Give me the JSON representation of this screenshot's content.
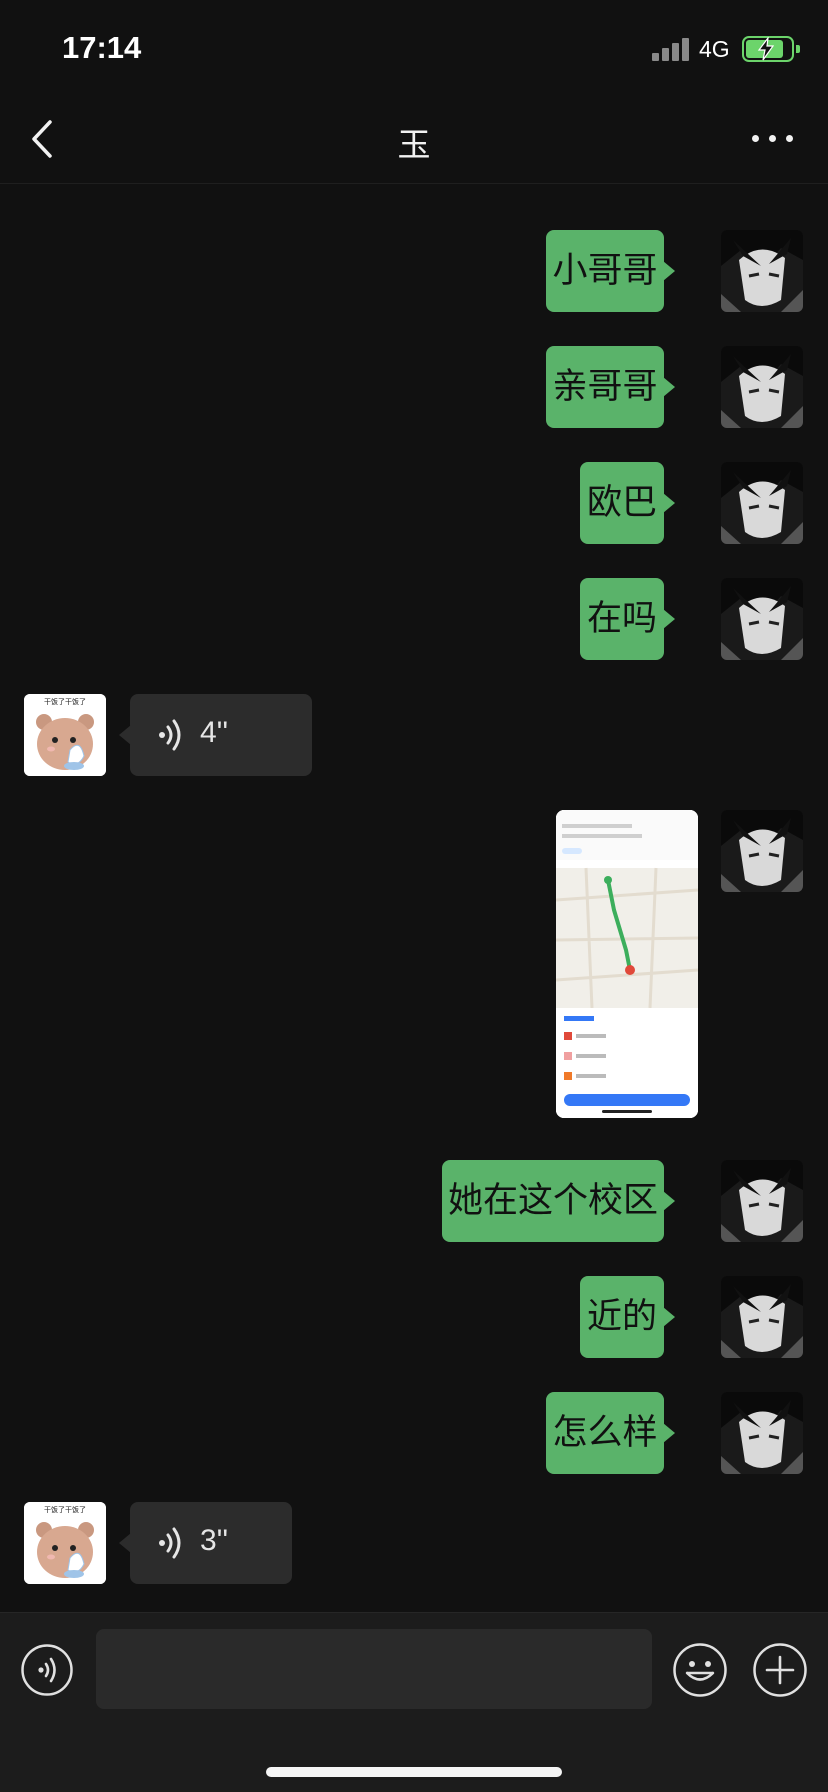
{
  "status": {
    "time": "17:14",
    "network": "4G",
    "battery_level": 0.85
  },
  "nav": {
    "title": "玉"
  },
  "messages": [
    {
      "side": "out",
      "type": "text",
      "text": "小哥哥"
    },
    {
      "side": "out",
      "type": "text",
      "text": "亲哥哥"
    },
    {
      "side": "out",
      "type": "text",
      "text": "欧巴"
    },
    {
      "side": "out",
      "type": "text",
      "text": "在吗"
    },
    {
      "side": "in",
      "type": "voice",
      "duration": "4''"
    },
    {
      "side": "out",
      "type": "image"
    },
    {
      "side": "out",
      "type": "text",
      "text": "她在这个校区"
    },
    {
      "side": "out",
      "type": "text",
      "text": "近的"
    },
    {
      "side": "out",
      "type": "text",
      "text": "怎么样"
    },
    {
      "side": "in",
      "type": "voice",
      "duration": "3''"
    }
  ],
  "avatar_sticker_text": "干饭了干饭了",
  "colors": {
    "background": "#111111",
    "outgoing_bubble": "#5ab36a",
    "incoming_bubble": "#2c2c2c",
    "input_bar": "#1c1c1c"
  },
  "icons": {
    "back": "chevron-left-icon",
    "more": "more-dots-icon",
    "voice_toggle": "voice-icon",
    "emoji": "emoji-icon",
    "plus": "plus-icon"
  }
}
